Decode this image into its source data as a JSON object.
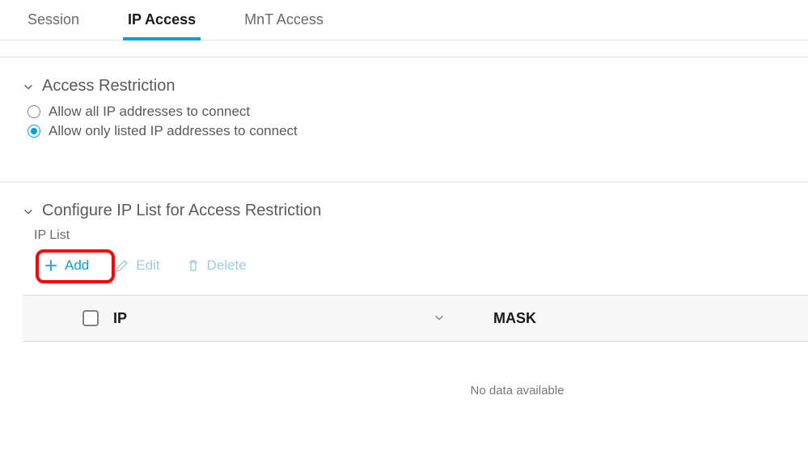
{
  "tabs": {
    "session": "Session",
    "ip_access": "IP Access",
    "mnt_access": "MnT Access"
  },
  "sections": {
    "access_restriction": {
      "title": "Access Restriction",
      "options": {
        "allow_all": "Allow all IP addresses to connect",
        "allow_listed": "Allow only listed IP addresses to connect"
      }
    },
    "configure_ip_list": {
      "title": "Configure IP List for Access Restriction",
      "subtitle": "IP List"
    }
  },
  "toolbar": {
    "add": "Add",
    "edit": "Edit",
    "delete": "Delete"
  },
  "table": {
    "columns": {
      "ip": "IP",
      "mask": "MASK"
    },
    "empty_message": "No data available"
  }
}
